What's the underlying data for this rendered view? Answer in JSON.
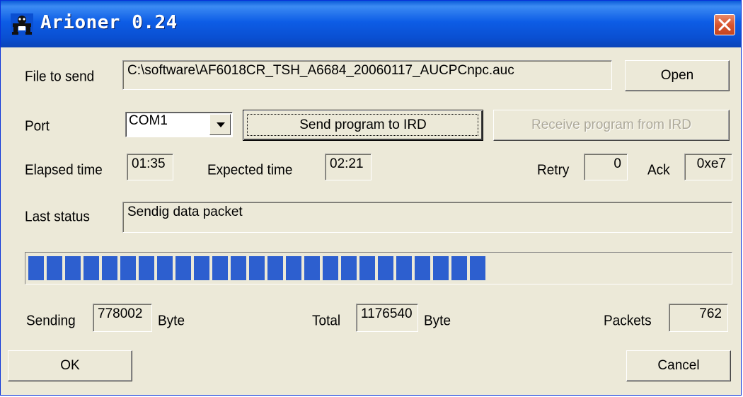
{
  "window": {
    "title": "Arioner 0.24",
    "icon": "arioner-app-icon",
    "close_icon": "close-icon"
  },
  "file": {
    "label": "File to send",
    "path": "C:\\software\\AF6018CR_TSH_A6684_20060117_AUCPCnpc.auc",
    "open_button": "Open"
  },
  "port": {
    "label": "Port",
    "selected": "COM1",
    "dropdown_icon": "chevron-down-icon",
    "send_button": "Send program to IRD",
    "receive_button": "Receive program from IRD"
  },
  "timing": {
    "elapsed_label": "Elapsed time",
    "elapsed_value": "01:35",
    "expected_label": "Expected time",
    "expected_value": "02:21",
    "retry_label": "Retry",
    "retry_value": "0",
    "ack_label": "Ack",
    "ack_value": "0xe7"
  },
  "status": {
    "label": "Last status",
    "value": "Sendig data packet"
  },
  "progress": {
    "fraction": 0.66
  },
  "counts": {
    "sending_label": "Sending",
    "sending_value": "778002",
    "sending_unit": "Byte",
    "total_label": "Total",
    "total_value": "1176540",
    "total_unit": "Byte",
    "packets_label": "Packets",
    "packets_value": "762"
  },
  "footer": {
    "ok_button": "OK",
    "cancel_button": "Cancel"
  },
  "colors": {
    "titlebar": "#0a5ad8",
    "progress_block": "#2d5fcf",
    "dialog_bg": "#ece9d8",
    "close_button": "#d8552f"
  }
}
